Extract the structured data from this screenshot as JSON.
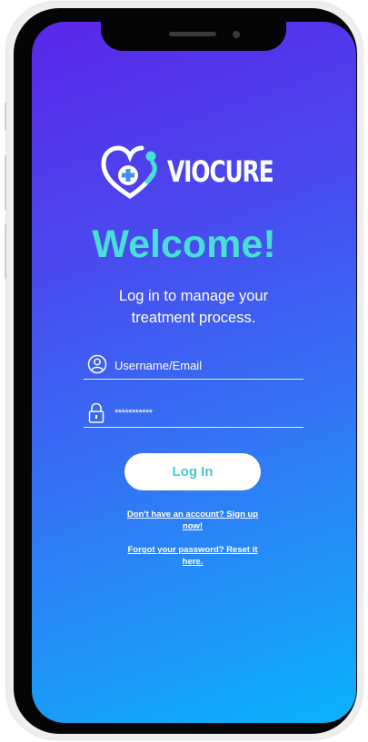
{
  "brand": {
    "name": "VIOCURE",
    "logo_icon": "heart-plus-icon",
    "accent_color": "#46e0d5"
  },
  "login": {
    "heading": "Welcome!",
    "subtitle": "Log in to manage your treatment process.",
    "username": {
      "icon": "user-icon",
      "placeholder": "Username/Email",
      "value": ""
    },
    "password": {
      "icon": "lock-icon",
      "value": "***********"
    },
    "submit_label": "Log In",
    "signup_link": "Don't have an account? Sign up now!",
    "reset_link": "Forgot your password? Reset it here."
  }
}
